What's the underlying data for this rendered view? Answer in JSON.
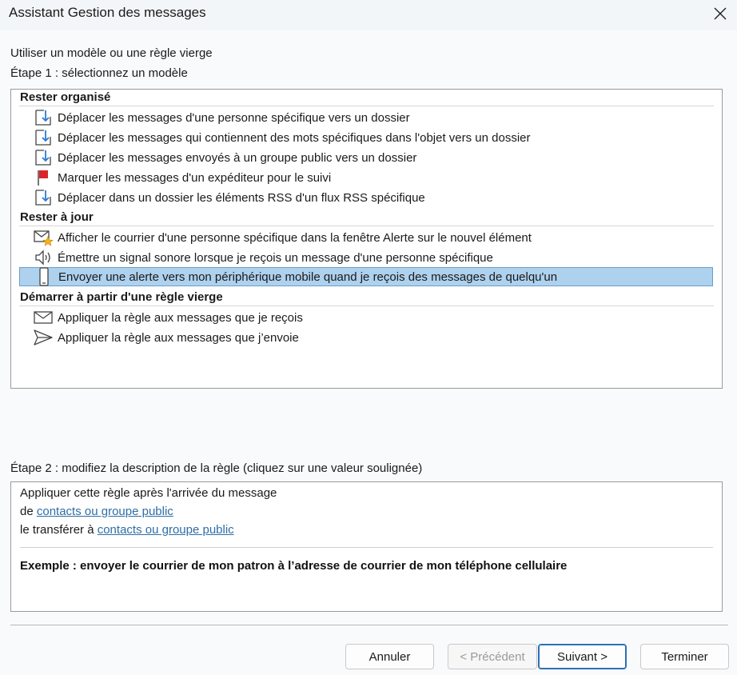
{
  "window": {
    "title": "Assistant Gestion des messages"
  },
  "intro": "Utiliser un modèle ou une règle vierge",
  "step1": "Étape 1 : sélectionnez un modèle",
  "groups": [
    {
      "header": "Rester organisé",
      "items": [
        {
          "label": "Déplacer les messages d'une personne spécifique vers un dossier",
          "icon": "move-to-folder-icon"
        },
        {
          "label": "Déplacer les messages qui contiennent des mots spécifiques dans l'objet vers un dossier",
          "icon": "move-to-folder-icon"
        },
        {
          "label": "Déplacer les messages envoyés à un groupe public vers un dossier",
          "icon": "move-to-folder-icon"
        },
        {
          "label": "Marquer les messages d'un expéditeur pour le suivi",
          "icon": "red-flag-icon"
        },
        {
          "label": "Déplacer dans un dossier les éléments RSS d'un flux RSS spécifique",
          "icon": "move-to-folder-icon"
        }
      ]
    },
    {
      "header": "Rester à jour",
      "items": [
        {
          "label": "Afficher le courrier d'une personne spécifique dans la fenêtre Alerte sur le nouvel élément",
          "icon": "mail-alert-star-icon"
        },
        {
          "label": "Émettre un signal sonore lorsque je reçois un message d'une personne spécifique",
          "icon": "speaker-icon"
        },
        {
          "label": "Envoyer une alerte vers mon périphérique mobile quand je reçois des messages de quelqu'un",
          "icon": "mobile-phone-icon",
          "selected": true
        }
      ]
    },
    {
      "header": "Démarrer à partir d'une règle vierge",
      "items": [
        {
          "label": "Appliquer la règle aux messages que je reçois",
          "icon": "envelope-icon"
        },
        {
          "label": "Appliquer la règle aux messages que j’envoie",
          "icon": "send-icon"
        }
      ]
    }
  ],
  "step2": "Étape 2 : modifiez la description de la règle (cliquez sur une valeur soulignée)",
  "description": {
    "line1": "Appliquer cette règle après l'arrivée du message",
    "line2_prefix": "de",
    "line2_link": "contacts ou groupe public",
    "line3_prefix": "le transférer à",
    "line3_link": "contacts ou groupe public",
    "example": "Exemple : envoyer le courrier de mon patron à l’adresse de courrier de mon téléphone cellulaire"
  },
  "buttons": {
    "cancel": "Annuler",
    "previous": "< Précédent",
    "next": "Suivant >",
    "finish": "Terminer"
  },
  "colors": {
    "selection": "#aed1ee",
    "link": "#2e6ea6",
    "flag": "#d9262b",
    "folder_arrow": "#2b7bd1"
  }
}
